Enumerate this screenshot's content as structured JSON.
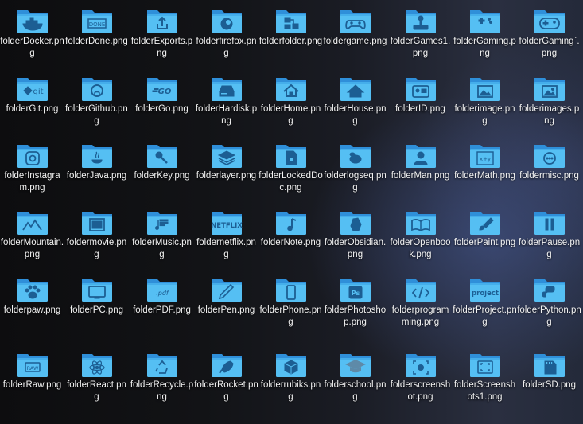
{
  "files": [
    {
      "name": "folderDocker.png",
      "icon": "docker-whale-icon"
    },
    {
      "name": "folderDone.png",
      "icon": "done-label-icon"
    },
    {
      "name": "folderExports.png",
      "icon": "export-upload-icon"
    },
    {
      "name": "folderfirefox.png",
      "icon": "firefox-icon"
    },
    {
      "name": "folderfolder.png",
      "icon": "folder-tree-icon"
    },
    {
      "name": "foldergame.png",
      "icon": "gamepad-icon"
    },
    {
      "name": "folderGames1.png",
      "icon": "arcade-joystick-icon"
    },
    {
      "name": "folderGaming.png",
      "icon": "game-controller-icon"
    },
    {
      "name": "folderGaming`.png",
      "icon": "game-controller-round-icon"
    },
    {
      "name": "folderGit.png",
      "icon": "git-icon"
    },
    {
      "name": "folderGithub.png",
      "icon": "github-icon"
    },
    {
      "name": "folderGo.png",
      "icon": "go-lang-icon"
    },
    {
      "name": "folderHardisk.png",
      "icon": "hard-disk-icon"
    },
    {
      "name": "folderHome.png",
      "icon": "home-icon"
    },
    {
      "name": "folderHouse.png",
      "icon": "house-icon"
    },
    {
      "name": "folderID.png",
      "icon": "id-card-icon"
    },
    {
      "name": "folderimage.png",
      "icon": "image-icon"
    },
    {
      "name": "folderimages.png",
      "icon": "images-icon"
    },
    {
      "name": "folderInstagram.png",
      "icon": "instagram-icon"
    },
    {
      "name": "folderJava.png",
      "icon": "java-icon"
    },
    {
      "name": "folderKey.png",
      "icon": "key-icon"
    },
    {
      "name": "folderlayer.png",
      "icon": "layers-icon"
    },
    {
      "name": "folderLockedDoc.png",
      "icon": "locked-document-icon"
    },
    {
      "name": "folderlogseq.png",
      "icon": "logseq-icon"
    },
    {
      "name": "folderMan.png",
      "icon": "person-icon"
    },
    {
      "name": "folderMath.png",
      "icon": "math-icon"
    },
    {
      "name": "foldermisc.png",
      "icon": "misc-dots-icon"
    },
    {
      "name": "folderMountain.png",
      "icon": "mountain-icon"
    },
    {
      "name": "foldermovie.png",
      "icon": "film-icon"
    },
    {
      "name": "folderMusic.png",
      "icon": "music-icon"
    },
    {
      "name": "foldernetflix.png",
      "icon": "netflix-icon"
    },
    {
      "name": "folderNote.png",
      "icon": "music-note-icon"
    },
    {
      "name": "folderObsidian.png",
      "icon": "obsidian-icon"
    },
    {
      "name": "folderOpenbook.png",
      "icon": "open-book-icon"
    },
    {
      "name": "folderPaint.png",
      "icon": "paint-brush-icon"
    },
    {
      "name": "folderPause.png",
      "icon": "pause-icon"
    },
    {
      "name": "folderpaw.png",
      "icon": "paw-icon"
    },
    {
      "name": "folderPC.png",
      "icon": "monitor-icon"
    },
    {
      "name": "folderPDF.png",
      "icon": "pdf-icon"
    },
    {
      "name": "folderPen.png",
      "icon": "pen-icon"
    },
    {
      "name": "folderPhone.png",
      "icon": "phone-icon"
    },
    {
      "name": "folderPhotoshop.png",
      "icon": "photoshop-icon"
    },
    {
      "name": "folderprogramming.png",
      "icon": "code-icon"
    },
    {
      "name": "folderProject.png",
      "icon": "project-icon"
    },
    {
      "name": "folderPython.png",
      "icon": "python-icon"
    },
    {
      "name": "folderRaw.png",
      "icon": "raw-icon"
    },
    {
      "name": "folderReact.png",
      "icon": "react-icon"
    },
    {
      "name": "folderRecycle.png",
      "icon": "recycle-icon"
    },
    {
      "name": "folderRocket.png",
      "icon": "rocket-icon"
    },
    {
      "name": "folderrubiks.png",
      "icon": "rubiks-cube-icon"
    },
    {
      "name": "folderschool.png",
      "icon": "graduation-cap-icon"
    },
    {
      "name": "folderscreenshot.png",
      "icon": "screenshot-camera-icon"
    },
    {
      "name": "folderScreenshots1.png",
      "icon": "screenshot-frame-icon"
    },
    {
      "name": "folderSD.png",
      "icon": "sd-card-icon"
    }
  ],
  "colors": {
    "folder_back": "#2f8fd9",
    "folder_front": "#55bff3",
    "folder_tab": "#3aa4e6",
    "glyph": "#1c5e93",
    "label_text": "#f2f2f2"
  }
}
